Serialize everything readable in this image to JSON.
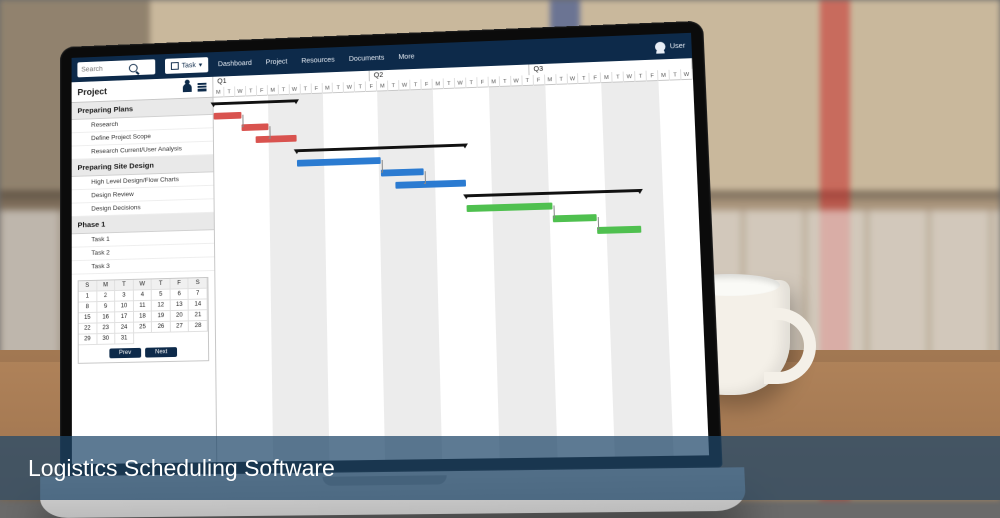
{
  "caption": "Logistics Scheduling Software",
  "topbar": {
    "search_placeholder": "Search",
    "search_button": "🔍",
    "task_label": "Task",
    "menu": [
      "Dashboard",
      "Project",
      "Resources",
      "Documents",
      "More"
    ],
    "user_label": "User"
  },
  "sidebar": {
    "title": "Project",
    "groups": [
      {
        "name": "Preparing Plans",
        "tasks": [
          "Research",
          "Define Project Scope",
          "Research Current/User Analysis"
        ]
      },
      {
        "name": "Preparing Site Design",
        "tasks": [
          "High Level Design/Flow Charts",
          "Design Review",
          "Design Decisions"
        ]
      },
      {
        "name": "Phase 1",
        "tasks": [
          "Task 1",
          "Task 2",
          "Task 3"
        ]
      }
    ],
    "calendar": {
      "dow": [
        "S",
        "M",
        "T",
        "W",
        "T",
        "F",
        "S"
      ],
      "days": [
        1,
        2,
        3,
        4,
        5,
        6,
        7,
        8,
        9,
        10,
        11,
        12,
        13,
        14,
        15,
        16,
        17,
        18,
        19,
        20,
        21,
        22,
        23,
        24,
        25,
        26,
        27,
        28,
        29,
        30,
        31
      ],
      "prev_label": "Prev",
      "next_label": "Next"
    }
  },
  "timeline": {
    "quarters": [
      "Q1",
      "Q2",
      "Q3"
    ],
    "day_letters": [
      "M",
      "T",
      "W",
      "T",
      "F",
      "M",
      "T",
      "W",
      "T",
      "F",
      "M",
      "T",
      "W",
      "T",
      "F",
      "M",
      "T",
      "W",
      "T",
      "F",
      "M",
      "T",
      "W",
      "T",
      "F",
      "M",
      "T",
      "W",
      "T",
      "F",
      "M",
      "T",
      "W",
      "T",
      "F",
      "M",
      "T",
      "W",
      "T",
      "F",
      "M",
      "T",
      "W"
    ]
  },
  "chart_data": {
    "type": "bar",
    "orientation": "horizontal-gantt",
    "x_unit": "week-index",
    "groups": [
      {
        "name": "Preparing Plans",
        "summary": [
          0,
          6
        ],
        "bars": [
          {
            "task": "Research",
            "start": 0,
            "end": 2,
            "color": "red"
          },
          {
            "task": "Define Project Scope",
            "start": 2,
            "end": 4,
            "color": "red"
          },
          {
            "task": "Research Current/User Analysis",
            "start": 3,
            "end": 6,
            "color": "red"
          }
        ]
      },
      {
        "name": "Preparing Site Design",
        "summary": [
          6,
          18
        ],
        "bars": [
          {
            "task": "High Level Design/Flow Charts",
            "start": 6,
            "end": 12,
            "color": "blue"
          },
          {
            "task": "Design Review",
            "start": 12,
            "end": 15,
            "color": "blue"
          },
          {
            "task": "Design Decisions",
            "start": 13,
            "end": 18,
            "color": "blue"
          }
        ]
      },
      {
        "name": "Phase 1",
        "summary": [
          18,
          30
        ],
        "bars": [
          {
            "task": "Task 1",
            "start": 18,
            "end": 24,
            "color": "green"
          },
          {
            "task": "Task 2",
            "start": 24,
            "end": 27,
            "color": "green"
          },
          {
            "task": "Task 3",
            "start": 27,
            "end": 30,
            "color": "green"
          }
        ]
      }
    ]
  }
}
